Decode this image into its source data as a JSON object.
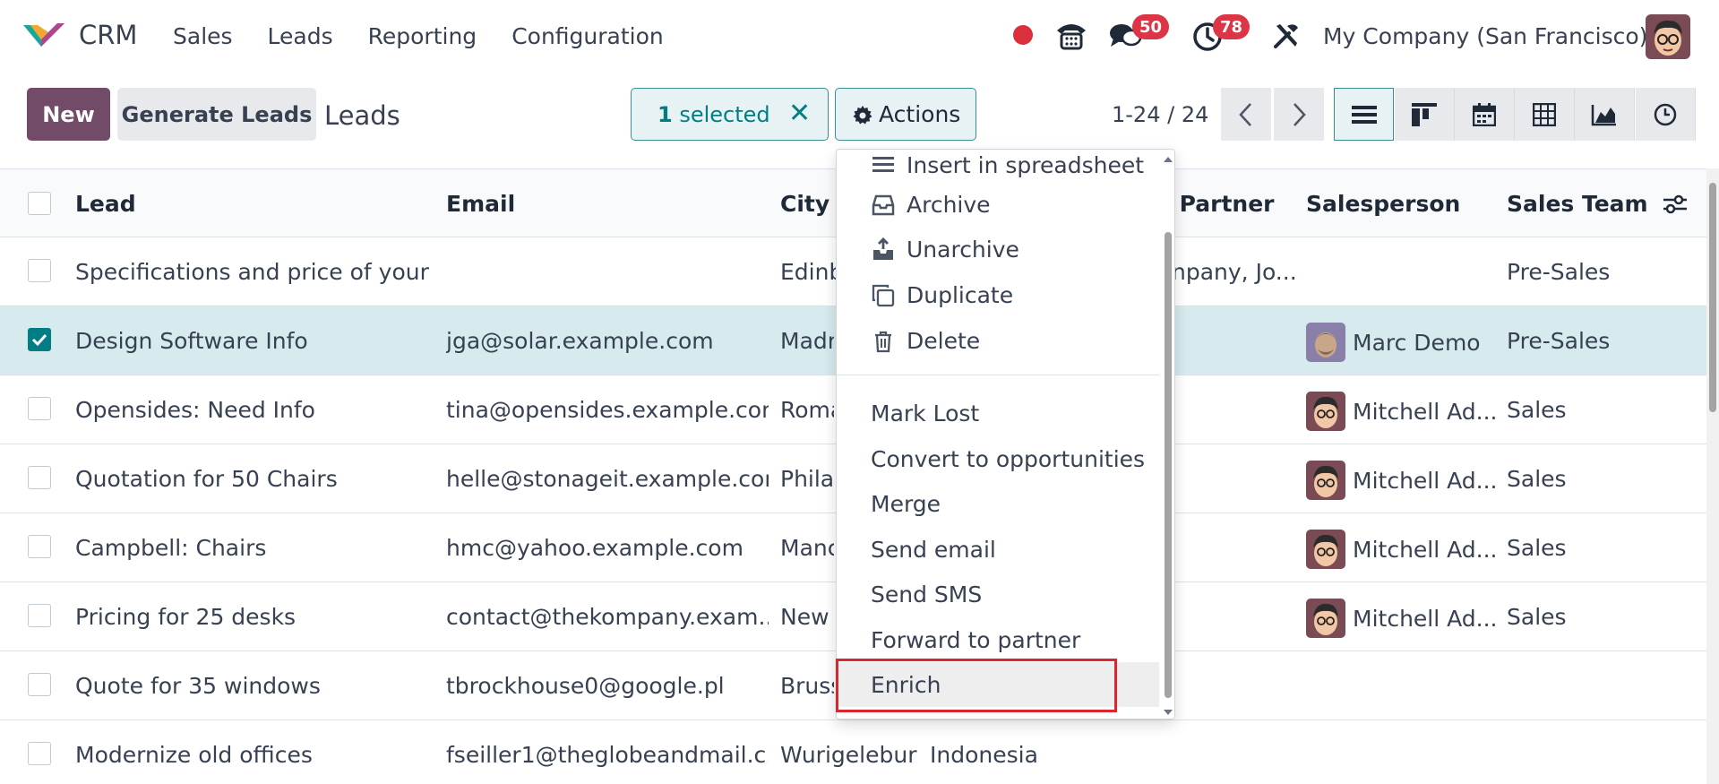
{
  "navbar": {
    "app_name": "CRM",
    "menu": [
      "Sales",
      "Leads",
      "Reporting",
      "Configuration"
    ],
    "messages_count": "50",
    "activities_count": "78",
    "company": "My Company (San Francisco)"
  },
  "control": {
    "new_label": "New",
    "generate_label": "Generate Leads",
    "breadcrumb": "Leads",
    "selected_count": "1",
    "selected_text": "selected",
    "actions_label": "Actions",
    "pager": "1-24 / 24"
  },
  "table": {
    "headers": {
      "lead": "Lead",
      "email": "Email",
      "city": "City",
      "partner": "d Partner",
      "salesperson": "Salesperson",
      "team": "Sales Team"
    },
    "rows": [
      {
        "lead": "Specifications and price of your ...",
        "email": "",
        "city": "Edinb",
        "partner": "npany, Jo...",
        "salesperson": "",
        "team": "Pre-Sales"
      },
      {
        "lead": "Design Software Info",
        "email": "jga@solar.example.com",
        "city": "Madr",
        "partner": "",
        "salesperson": "Marc Demo",
        "team": "Pre-Sales"
      },
      {
        "lead": "Opensides: Need Info",
        "email": "tina@opensides.example.com",
        "city": "Roma",
        "partner": "",
        "salesperson": "Mitchell Ad...",
        "team": "Sales"
      },
      {
        "lead": "Quotation for 50 Chairs",
        "email": "helle@stonageit.example.com",
        "city": "Philac",
        "partner": "",
        "salesperson": "Mitchell Ad...",
        "team": "Sales"
      },
      {
        "lead": "Campbell: Chairs",
        "email": "hmc@yahoo.example.com",
        "city": "Manc",
        "partner": "",
        "salesperson": "Mitchell Ad...",
        "team": "Sales"
      },
      {
        "lead": "Pricing for 25 desks",
        "email": "contact@thekompany.exam...",
        "city": "New Y",
        "partner": "",
        "salesperson": "Mitchell Ad...",
        "team": "Sales"
      },
      {
        "lead": "Quote for 35 windows",
        "email": "tbrockhouse0@google.pl",
        "city": "Bruss",
        "partner": "",
        "salesperson": "",
        "team": ""
      },
      {
        "lead": "Modernize old offices",
        "email": "fseiller1@theglobeandmail.c...",
        "city": "Wurigelebur",
        "partner": "Indonesia",
        "salesperson": "",
        "team": ""
      }
    ]
  },
  "actions_menu": {
    "items": [
      {
        "label": "Insert in spreadsheet",
        "icon": "spreadsheet-icon"
      },
      {
        "label": "Archive",
        "icon": "archive-icon"
      },
      {
        "label": "Unarchive",
        "icon": "unarchive-icon"
      },
      {
        "label": "Duplicate",
        "icon": "duplicate-icon"
      },
      {
        "label": "Delete",
        "icon": "trash-icon"
      }
    ],
    "plain_items": [
      "Mark Lost",
      "Convert to opportunities",
      "Merge",
      "Send email",
      "Send SMS",
      "Forward to partner",
      "Enrich"
    ]
  },
  "colors": {
    "brand": "#714b67",
    "accent": "#017e84",
    "badge": "#dc3545",
    "highlight_border": "#d9262f"
  }
}
